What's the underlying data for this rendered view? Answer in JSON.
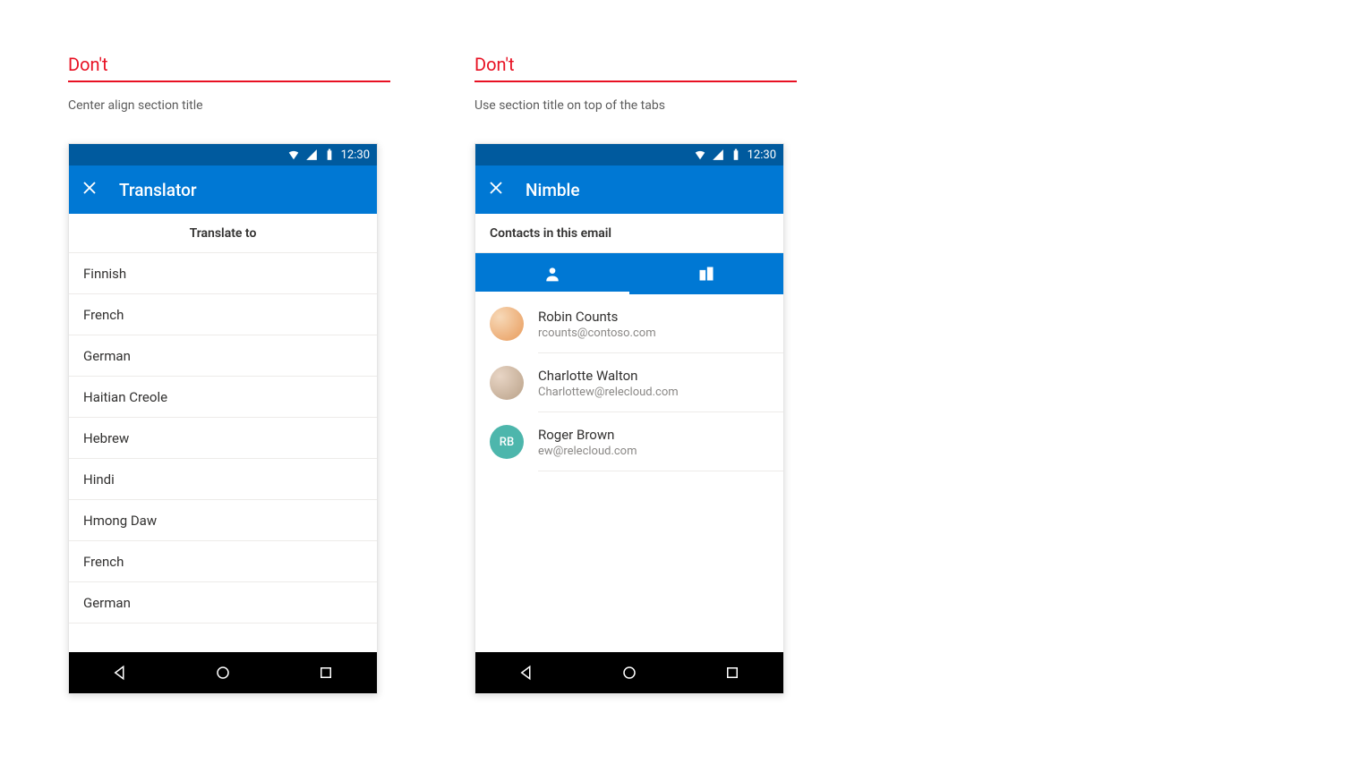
{
  "examples": [
    {
      "label": "Don't",
      "caption": "Center align section title",
      "statusbar": {
        "time": "12:30"
      },
      "appbar": {
        "title": "Translator"
      },
      "section_title": "Translate to",
      "languages": [
        "Finnish",
        "French",
        "German",
        "Haitian Creole",
        "Hebrew",
        "Hindi",
        "Hmong Daw",
        "French",
        "German"
      ]
    },
    {
      "label": "Don't",
      "caption": "Use section title on top of the tabs",
      "statusbar": {
        "time": "12:30"
      },
      "appbar": {
        "title": "Nimble"
      },
      "section_title": "Contacts in this email",
      "contacts": [
        {
          "name": "Robin Counts",
          "email": "rcounts@contoso.com",
          "avatar_type": "photo1",
          "initials": ""
        },
        {
          "name": "Charlotte Walton",
          "email": "Charlottew@relecloud.com",
          "avatar_type": "photo2",
          "initials": ""
        },
        {
          "name": "Roger Brown",
          "email": "ew@relecloud.com",
          "avatar_type": "initials",
          "initials": "RB"
        }
      ]
    }
  ]
}
